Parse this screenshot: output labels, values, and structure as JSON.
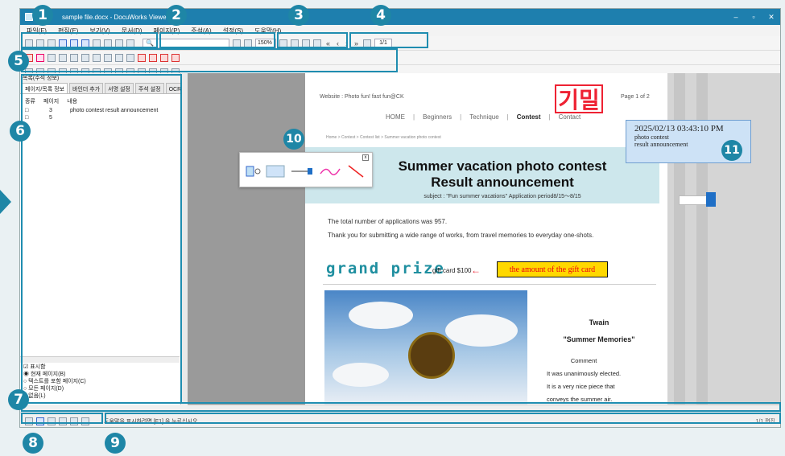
{
  "window": {
    "title": "sample file.docx - DocuWorks Viewer",
    "controls": [
      "–",
      "▫",
      "✕"
    ]
  },
  "menu": [
    "파일(F)",
    "편집(E)",
    "보기(V)",
    "문서(D)",
    "페이지(P)",
    "주석(A)",
    "설정(S)",
    "도움말(H)"
  ],
  "search": {
    "placeholder": ""
  },
  "zoom": {
    "value": "150%"
  },
  "page_nav": {
    "current": "1/1",
    "buttons": [
      "«",
      "‹",
      "›",
      "»"
    ]
  },
  "sidebar": {
    "title": "목록(주석 정보)",
    "tabs": [
      "페이지/목록 정보",
      "바인더 추가",
      "서명 설정",
      "주석 설정",
      "OCR 결과"
    ],
    "head": [
      "종류",
      "페이지",
      "내용"
    ],
    "rows": [
      {
        "type": "□",
        "page": "3",
        "text": "photo contest result announcement"
      },
      {
        "type": "□",
        "page": "5",
        "text": ""
      }
    ],
    "options": [
      "☑ 표시함",
      "◉ 현재 페이지(B)",
      "○ 텍스트를 포함 페이지(C)",
      "○ 모든 페이지(D)",
      "○ 없음(L)"
    ]
  },
  "document": {
    "website": "Website : Photo fun! fast fun@CK",
    "stamp": "기밀",
    "page_of": "Page 1 of 2",
    "nav": [
      "HOME",
      "Beginners",
      "Technique",
      "Contest",
      "Contact"
    ],
    "breadcrumb": "Home  >  Contest  >  Contest list  >  Summer vacation photo contest",
    "heading_line1": "Summer vacation photo contest",
    "heading_line2": "Result announcement",
    "subject": "subject : \"Fun summer vacations\" Application period8/15～8/15",
    "para1": "The total number of applications was 957.",
    "para2": "Thank you for submitting a wide range of works, from travel memories to everyday one-shots.",
    "grand_prize": "grand prize",
    "gift": "gift card $100",
    "gift_note": "the amount of the gift card",
    "author": "Twain",
    "work_title": "\"Summer Memories\"",
    "comment_head": "Comment",
    "comment_lines": [
      "It was unanimously elected.",
      "It is a very nice piece that",
      "conveys the summer air."
    ]
  },
  "annotation": {
    "timestamp": "2025/02/13 03:43:10 PM",
    "lines": [
      "photo contest",
      "result announcement"
    ]
  },
  "status": {
    "message": "도움말을 표시하려면 [F1] 을 누르십시오.",
    "right": "1/1  편집"
  },
  "callouts": [
    "1",
    "2",
    "3",
    "4",
    "5",
    "6",
    "7",
    "8",
    "9",
    "10",
    "11"
  ],
  "colors": {
    "accent": "#1e86a6",
    "stamp": "#e22233",
    "annotation_bg": "#cde2f6",
    "gift_bg": "#ffd800"
  }
}
